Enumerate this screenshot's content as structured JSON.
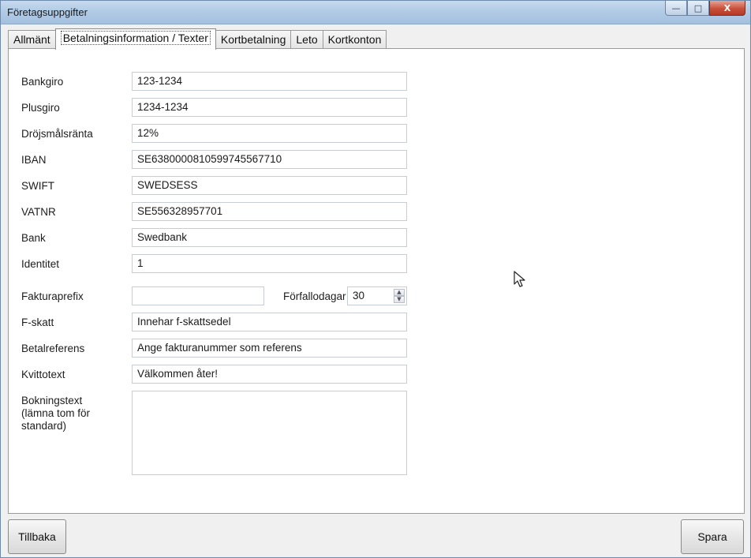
{
  "window": {
    "title": "Företagsuppgifter"
  },
  "window_controls": {
    "minimize": "—",
    "maximize": "□",
    "close": "X"
  },
  "tabs": [
    {
      "label": "Allmänt",
      "active": false
    },
    {
      "label": "Betalningsinformation / Texter",
      "active": true
    },
    {
      "label": "Kortbetalning",
      "active": false
    },
    {
      "label": "Leto",
      "active": false
    },
    {
      "label": "Kortkonton",
      "active": false
    }
  ],
  "form": {
    "bankgiro": {
      "label": "Bankgiro",
      "value": "123-1234"
    },
    "plusgiro": {
      "label": "Plusgiro",
      "value": "1234-1234"
    },
    "drojsmalsranta": {
      "label": "Dröjsmålsränta",
      "value": "12%"
    },
    "iban": {
      "label": "IBAN",
      "value": "SE6380000810599745567710"
    },
    "swift": {
      "label": "SWIFT",
      "value": "SWEDSESS"
    },
    "vatnr": {
      "label": "VATNR",
      "value": "SE556328957701"
    },
    "bank": {
      "label": "Bank",
      "value": "Swedbank"
    },
    "identitet": {
      "label": "Identitet",
      "value": "1"
    },
    "fakturaprefix": {
      "label": "Fakturaprefix",
      "value": ""
    },
    "forfallodagar": {
      "label": "Förfallodagar",
      "value": "30"
    },
    "fskatt": {
      "label": "F-skatt",
      "value": "Innehar f-skattsedel"
    },
    "betalreferens": {
      "label": "Betalreferens",
      "value": "Ange fakturanummer som referens"
    },
    "kvittotext": {
      "label": "Kvittotext",
      "value": "Välkommen åter!"
    },
    "bokningstext": {
      "label": "Bokningstext (lämna tom för standard)",
      "value": ""
    }
  },
  "footer": {
    "back_label": "Tillbaka",
    "save_label": "Spara"
  }
}
